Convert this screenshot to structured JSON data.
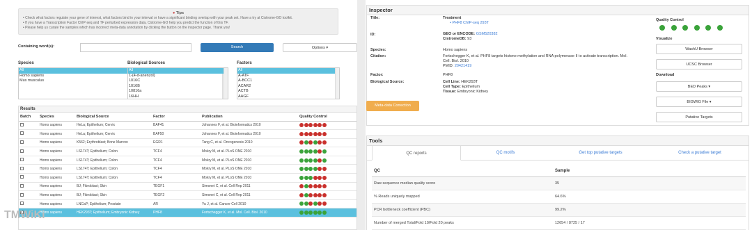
{
  "tips": {
    "title": "Tips",
    "lines": [
      "• Check what factors regulate your gene of interest, what factors bind in your interval or have a significant binding overlap with your peak set. Have a try at Cistrome-GO toolkit.",
      "• If you have a Transcription Factor ChIP-seq and TF perturbed expression data, Cistrome-GO help you predict the function of this TF.",
      "• Please help us curate the samples which has incorrect meta-data annotation by clicking the button on the inspector page. Thank you!"
    ]
  },
  "search": {
    "label": "Containing word(s):",
    "placeholder": "",
    "button": "Search",
    "options": "Options ▾"
  },
  "filters": {
    "species": {
      "title": "Species",
      "items": [
        "All",
        "Homo sapiens",
        "Mus musculus"
      ]
    },
    "bio": {
      "title": "Biological Sources",
      "items": [
        "All",
        "1-(4-d-anenzol)",
        "1016C",
        "1016B",
        "10816a",
        "16HH"
      ]
    },
    "factors": {
      "title": "Factors",
      "items": [
        "All",
        "A-ATF",
        "A-BCC1",
        "ACAR2",
        "ACTB",
        "AAGF"
      ]
    }
  },
  "results": {
    "title": "Results",
    "headers": [
      "Batch",
      "Species",
      "Biological Source",
      "Factor",
      "Publication",
      "Quality Control"
    ],
    "rows": [
      {
        "species": "Homo sapiens",
        "bio": "HeLa; Epithelium; Cervix",
        "factor": "BAF41",
        "pub": "Johannes F, et al. Bioinformatics 2010",
        "qc": [
          "r",
          "r",
          "r",
          "r",
          "r",
          "r"
        ]
      },
      {
        "species": "Homo sapiens",
        "bio": "HeLa; Epithelium; Cervix",
        "factor": "BAF50",
        "pub": "Johannes F, et al. Bioinformatics 2010",
        "qc": [
          "r",
          "r",
          "r",
          "r",
          "r",
          "r"
        ]
      },
      {
        "species": "Homo sapiens",
        "bio": "K562; Erythroblast; Bone Marrow",
        "factor": "EGR1",
        "pub": "Tang C, et al. Oncogenesis 2010",
        "qc": [
          "r",
          "g",
          "r",
          "g",
          "r",
          "r"
        ]
      },
      {
        "species": "Homo sapiens",
        "bio": "LS174T; Epithelium; Colon",
        "factor": "TCF4",
        "pub": "Mokry M, et al. PLoS ONE 2010",
        "qc": [
          "g",
          "g",
          "g",
          "g",
          "r",
          "g"
        ]
      },
      {
        "species": "Homo sapiens",
        "bio": "LS174T; Epithelium; Colon",
        "factor": "TCF4",
        "pub": "Mokry M, et al. PLoS ONE 2010",
        "qc": [
          "g",
          "g",
          "g",
          "g",
          "r",
          "g"
        ]
      },
      {
        "species": "Homo sapiens",
        "bio": "LS174T; Epithelium; Colon",
        "factor": "TCF4",
        "pub": "Mokry M, et al. PLoS ONE 2010",
        "qc": [
          "g",
          "g",
          "g",
          "g",
          "r",
          "r"
        ]
      },
      {
        "species": "Homo sapiens",
        "bio": "LS174T; Epithelium; Colon",
        "factor": "TCF4",
        "pub": "Mokry M, et al. PLoS ONE 2010",
        "qc": [
          "g",
          "g",
          "g",
          "r",
          "r",
          "r"
        ]
      },
      {
        "species": "Homo sapiens",
        "bio": "BJ; Fibroblast; Skin",
        "factor": "TEGF1",
        "pub": "Simonet C, et al. Cell Rep 2011",
        "qc": [
          "r",
          "g",
          "r",
          "r",
          "r",
          "r"
        ]
      },
      {
        "species": "Homo sapiens",
        "bio": "BJ; Fibroblast; Skin",
        "factor": "TEGF2",
        "pub": "Simonet C, et al. Cell Rep 2011",
        "qc": [
          "r",
          "g",
          "r",
          "r",
          "r",
          "r"
        ]
      },
      {
        "species": "Homo sapiens",
        "bio": "LNCaP; Epithelium; Prostate",
        "factor": "AR",
        "pub": "Yu J, et al. Cancer Cell 2010",
        "qc": [
          "g",
          "g",
          "r",
          "g",
          "r",
          "r"
        ]
      },
      {
        "species": "Homo sapiens",
        "bio": "HEK293T; Epithelium; Embryonic Kidney",
        "factor": "PHF8",
        "pub": "Fortschegger K, et al. Mol. Cell. Biol. 2010",
        "qc": [
          "g",
          "g",
          "g",
          "g",
          "g",
          "g"
        ],
        "selected": true
      }
    ]
  },
  "inspector": {
    "title": "Inspector",
    "labels": {
      "title": "Title:",
      "id": "ID:",
      "species": "Species:",
      "citation": "Citation:",
      "factor": "Factor:",
      "bio": "Biological Source:"
    },
    "title_head": "Treatment",
    "title_link": "• PHF8 ChIP-seq 293T",
    "geo_label": "GEO or ENCODE:",
    "geo_value": "GSM520382",
    "cistrome_label": "CistromeDB:",
    "cistrome_value": "93",
    "species": "Homo sapiens",
    "citation": "Fortschegger K, et al. PHF8 targets histone methylation and RNA polymerase II to activate transcription. Mol. Cell. Biol. 2010",
    "pmid_label": "PMID:",
    "pmid": "20421419",
    "factor": "PHF8",
    "cell_line_label": "Cell Line:",
    "cell_line": "HEK293T",
    "cell_type_label": "Cell Type:",
    "cell_type": "Epithelium",
    "tissue_label": "Tissue:",
    "tissue": "Embryonic Kidney",
    "meta_button": "Meta-data Correction",
    "qc_title": "Quality Control",
    "visualize_title": "Visualize",
    "washu": "WashU Browser",
    "ucsc": "UCSC Browser",
    "download_title": "Download",
    "bed": "BED Peaks ▾",
    "bigwig": "BIGWIG File ▾",
    "putative": "Putative Targets"
  },
  "tools": {
    "title": "Tools",
    "tabs": [
      "QC reports",
      "QC motifs",
      "Get top putative targets",
      "Check a putative target"
    ],
    "headers": [
      "QC",
      "Sample"
    ],
    "rows": [
      [
        "Raw sequence median quality score",
        "35"
      ],
      [
        "% Reads uniquely mapped",
        "64.6%"
      ],
      [
        "PCR bottleneck coefficient (PBC)",
        "99.2%"
      ],
      [
        "Number of merged Total/Fold 10/Fold 20 peaks",
        "12654 / 8725 / 17"
      ]
    ]
  },
  "watermark": "TMWiKi"
}
